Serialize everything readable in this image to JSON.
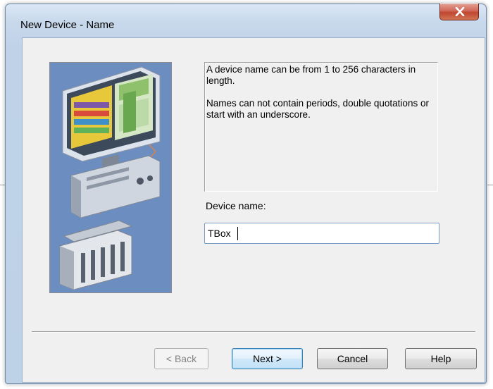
{
  "window": {
    "title": "New Device - Name"
  },
  "info": {
    "line1": "A device name can be from 1 to 256 characters in length.",
    "line2": "Names can not contain periods, double quotations or start with an underscore."
  },
  "device_name": {
    "label": "Device name:",
    "value": "TBox"
  },
  "buttons": {
    "back": "< Back",
    "next": "Next >",
    "cancel": "Cancel",
    "help": "Help"
  },
  "icons": {
    "close": "close-icon",
    "illustration": "computer-and-plc-illustration"
  }
}
